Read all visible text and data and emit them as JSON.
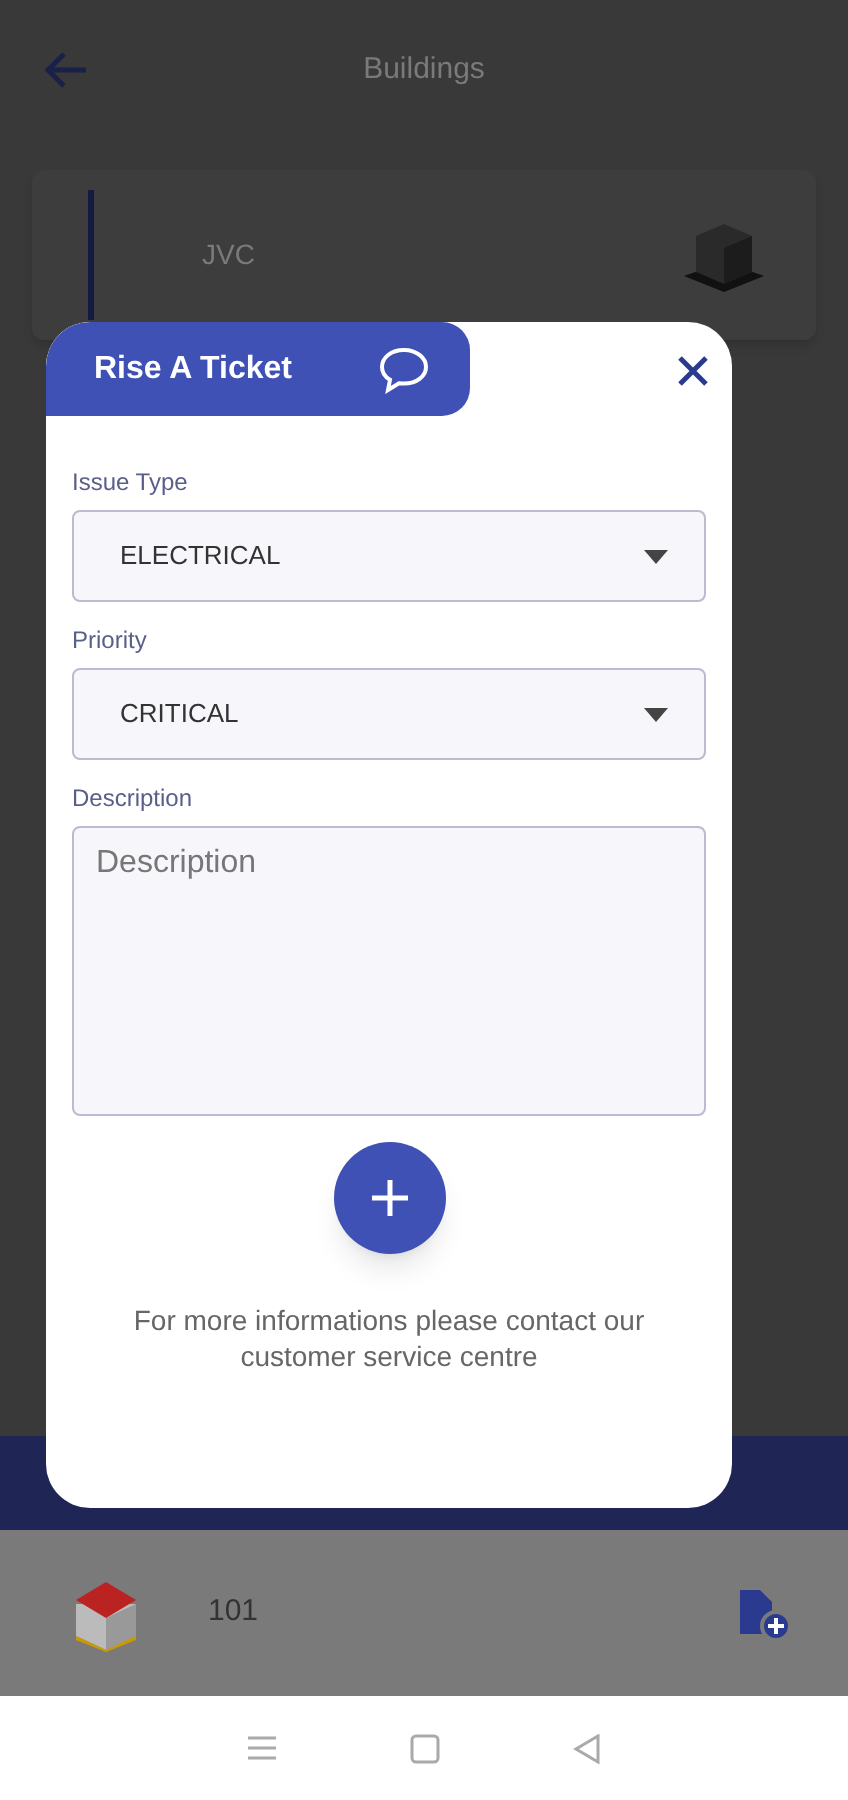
{
  "header": {
    "title": "Buildings"
  },
  "building_card": {
    "name": "JVC"
  },
  "unit_row": {
    "name": "101"
  },
  "dialog": {
    "title": "Rise A Ticket",
    "fields": [
      {
        "kind": "select",
        "label": "Issue Type",
        "value": "ELECTRICAL"
      },
      {
        "kind": "select",
        "label": "Priority",
        "value": "CRITICAL"
      },
      {
        "kind": "textarea",
        "label": "Description",
        "placeholder": "Description"
      }
    ],
    "footer_text": "For more informations please contact our customer service centre"
  }
}
